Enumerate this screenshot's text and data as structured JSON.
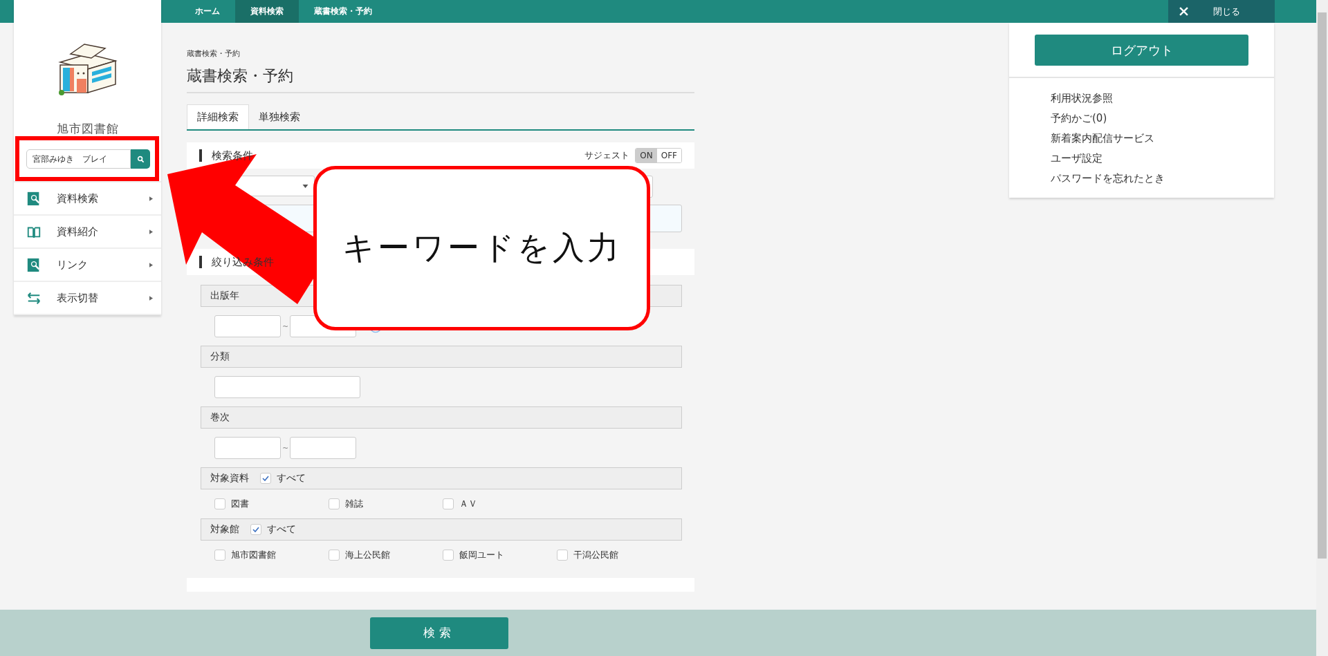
{
  "breadcrumbs": [
    {
      "label": "ホーム",
      "selected": false
    },
    {
      "label": "資料検索",
      "selected": true
    },
    {
      "label": "蔵書検索・予約",
      "selected": false
    }
  ],
  "close_button": {
    "label": "閉じる"
  },
  "sidebar": {
    "library_name": "旭市図書館",
    "search": {
      "value": "宮部みゆき　ブレイ"
    },
    "menu": [
      {
        "label": "資料検索",
        "kind": "search"
      },
      {
        "label": "資料紹介",
        "kind": "book"
      },
      {
        "label": "リンク",
        "kind": "search"
      },
      {
        "label": "表示切替",
        "kind": "swap"
      }
    ]
  },
  "page": {
    "breadcrumb": "蔵書検索・予約",
    "title": "蔵書検索・予約"
  },
  "tabs": [
    {
      "label": "詳細検索",
      "selected": true
    },
    {
      "label": "単独検索",
      "selected": false
    }
  ],
  "search_conditions": {
    "heading": "検索条件",
    "suggest_label": "サジェスト",
    "suggest_options": [
      {
        "label": "ON",
        "selected": true
      },
      {
        "label": "OFF",
        "selected": false
      }
    ]
  },
  "filters": {
    "heading": "絞り込み条件",
    "groups": [
      {
        "kind": "range",
        "label": "出版年",
        "separator": "~",
        "info": true
      },
      {
        "kind": "text",
        "label": "分類"
      },
      {
        "kind": "range",
        "label": "巻次",
        "separator": "~",
        "info": false
      },
      {
        "kind": "checks",
        "label": "対象資料",
        "all": {
          "label": "すべて",
          "checked": true
        },
        "options": [
          {
            "label": "図書",
            "checked": false
          },
          {
            "label": "雑誌",
            "checked": false
          },
          {
            "label": "ＡＶ",
            "checked": false
          }
        ]
      },
      {
        "kind": "checks",
        "label": "対象館",
        "all": {
          "label": "すべて",
          "checked": true
        },
        "options": [
          {
            "label": "旭市図書館",
            "checked": false
          },
          {
            "label": "海上公民館",
            "checked": false
          },
          {
            "label": "飯岡ユート",
            "checked": false
          },
          {
            "label": "干潟公民館",
            "checked": false
          }
        ]
      }
    ]
  },
  "footer": {
    "search_button": "検索"
  },
  "user_panel": {
    "logout": "ログアウト",
    "links": [
      "利用状況参照",
      "予約かご(0)",
      "新着案内配信サービス",
      "ユーザ設定",
      "パスワードを忘れたとき"
    ]
  },
  "annotation": {
    "callout": "キーワードを入力"
  }
}
